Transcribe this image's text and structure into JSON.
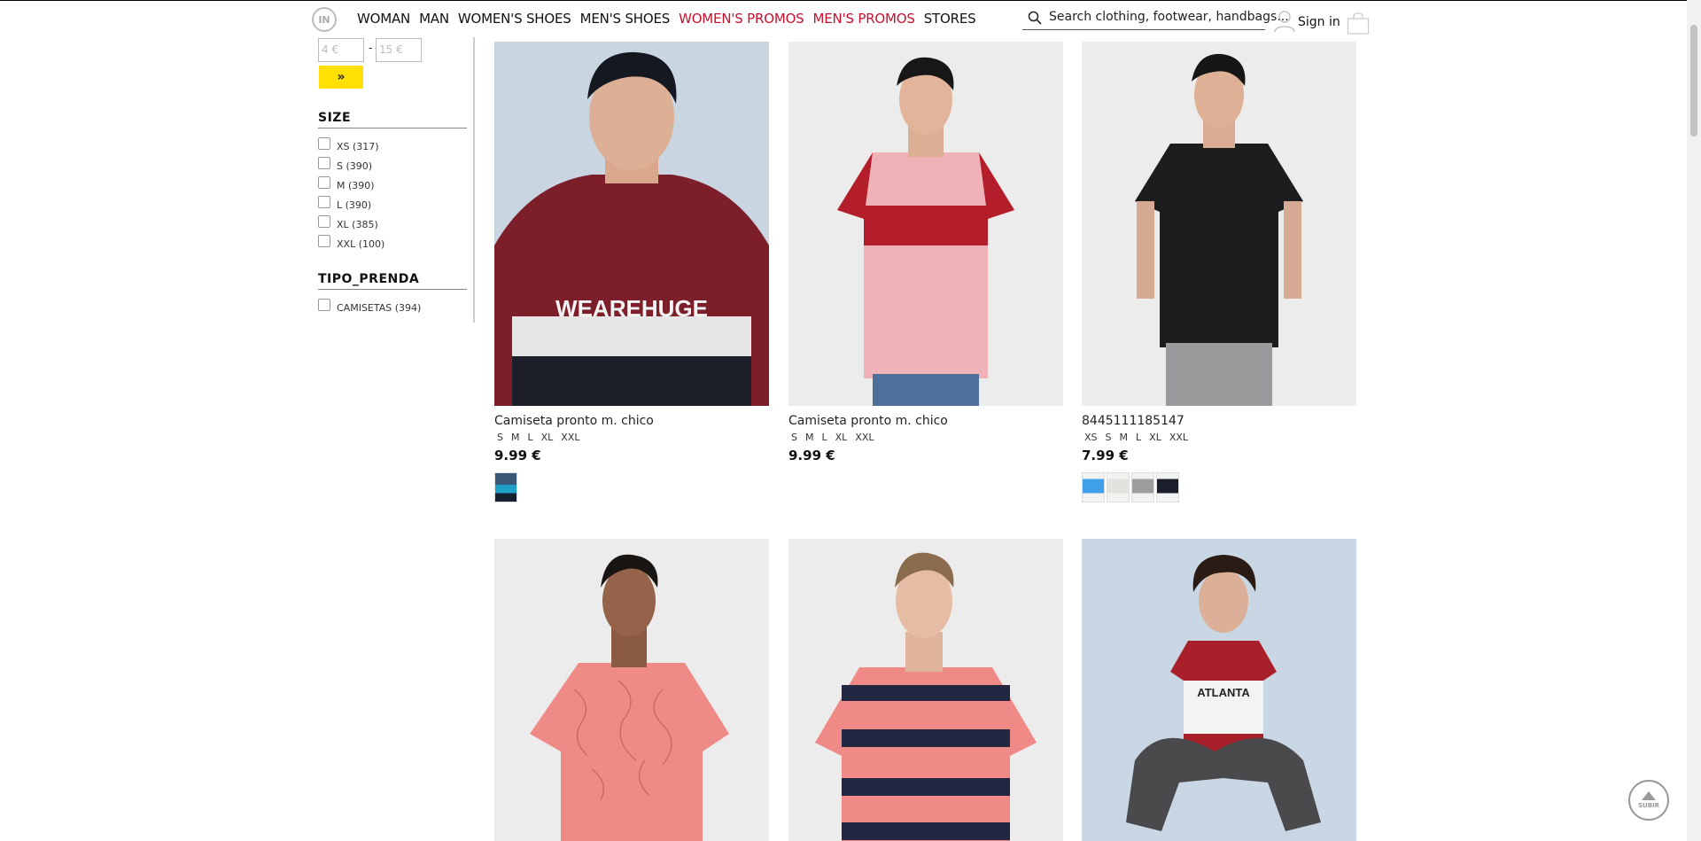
{
  "header": {
    "logo_text": "IN",
    "nav": [
      {
        "label": "WOMAN",
        "promo": false
      },
      {
        "label": "MAN",
        "promo": false
      },
      {
        "label": "WOMEN'S SHOES",
        "promo": false
      },
      {
        "label": "MEN'S SHOES",
        "promo": false
      },
      {
        "label": "WOMEN'S PROMOS",
        "promo": true
      },
      {
        "label": "MEN'S PROMOS",
        "promo": true
      },
      {
        "label": "STORES",
        "promo": false
      }
    ],
    "search_placeholder": "Search clothing, footwear, handbags...",
    "signin_label": "Sign in"
  },
  "sidebar": {
    "price_min": "4 €",
    "price_max": "15 €",
    "price_go": "»",
    "size_title": "SIZE",
    "sizes": [
      "XS (317)",
      "S (390)",
      "M (390)",
      "L (390)",
      "XL (385)",
      "XXL (100)"
    ],
    "tipo_title": "TIPO_PRENDA",
    "tipos": [
      "CAMISETAS (394)"
    ]
  },
  "products": [
    {
      "title": "Camiseta pronto m. chico",
      "sizes": [
        "S",
        "M",
        "L",
        "XL",
        "XXL"
      ],
      "price": "9.99 €"
    },
    {
      "title": "Camiseta pronto m. chico",
      "sizes": [
        "S",
        "M",
        "L",
        "XL",
        "XXL"
      ],
      "price": "9.99 €"
    },
    {
      "title": "8445111185147",
      "sizes": [
        "XS",
        "S",
        "M",
        "L",
        "XL",
        "XXL"
      ],
      "price": "7.99 €"
    }
  ],
  "up_button_label": "SUBIR",
  "colors": {
    "promo": "#c8102e",
    "filter_button": "#ffe000"
  }
}
